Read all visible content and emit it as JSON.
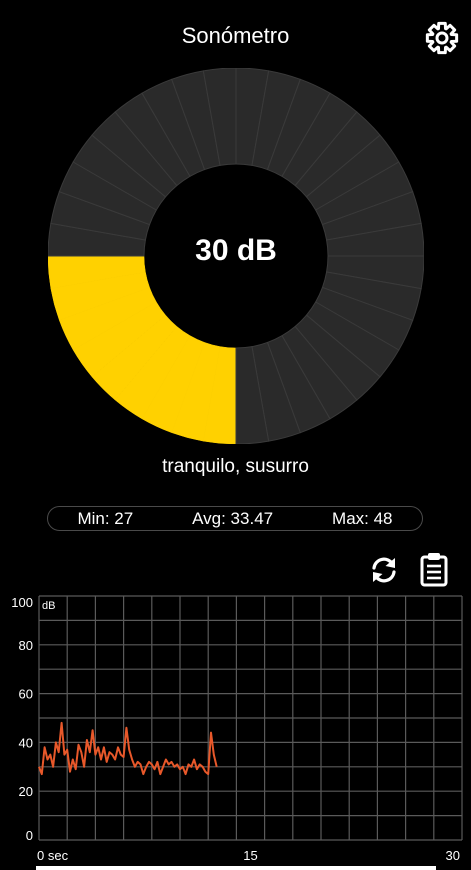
{
  "header": {
    "title": "Sonómetro",
    "settings_icon": "gear-icon"
  },
  "meter": {
    "reading": "30 dB",
    "fill_fraction": 0.25,
    "segments": 36,
    "fill_color": "#FFD100",
    "track_color": "#2A2A2A",
    "description": "tranquilo, susurro"
  },
  "stats": {
    "min": "Min: 27",
    "avg": "Avg: 33.47",
    "max": "Max: 48"
  },
  "actions": {
    "reset_icon": "refresh-icon",
    "clipboard_icon": "clipboard-icon"
  },
  "chart_data": {
    "type": "line",
    "unit_label": "dB",
    "y_ticks": [
      "0",
      "20",
      "40",
      "60",
      "80",
      "100"
    ],
    "x_ticks": [
      "0 sec",
      "15",
      "30"
    ],
    "ylim": [
      0,
      100
    ],
    "xlim": [
      0,
      30
    ],
    "grid": true,
    "line_color": "#E8582A",
    "series": [
      {
        "x": [
          0,
          0.2,
          0.4,
          0.6,
          0.8,
          1.0,
          1.2,
          1.4,
          1.6,
          1.8,
          2.0,
          2.2,
          2.4,
          2.6,
          2.8,
          3.0,
          3.2,
          3.4,
          3.6,
          3.8,
          4.0,
          4.2,
          4.4,
          4.6,
          4.8,
          5.0,
          5.2,
          5.4,
          5.6,
          5.8,
          6.0,
          6.2,
          6.4,
          6.6,
          6.8,
          7.0,
          7.2,
          7.4,
          7.6,
          7.8,
          8.0,
          8.2,
          8.4,
          8.6,
          8.8,
          9.0,
          9.2,
          9.4,
          9.6,
          9.8,
          10.0,
          10.2,
          10.4,
          10.6,
          10.8,
          11.0,
          11.2,
          11.4,
          11.6,
          11.8,
          12.0,
          12.2,
          12.4,
          12.6
        ],
        "y": [
          30,
          27,
          38,
          33,
          35,
          30,
          40,
          36,
          48,
          35,
          37,
          28,
          33,
          29,
          39,
          36,
          30,
          41,
          36,
          45,
          35,
          38,
          33,
          38,
          32,
          36,
          35,
          33,
          38,
          35,
          34,
          46,
          37,
          33,
          30,
          32,
          31,
          27,
          30,
          32,
          31,
          29,
          32,
          27,
          30,
          33,
          31,
          32,
          30,
          31,
          29,
          30,
          27,
          31,
          30,
          33,
          29,
          31,
          30,
          28,
          27,
          44,
          35,
          30
        ]
      }
    ]
  }
}
